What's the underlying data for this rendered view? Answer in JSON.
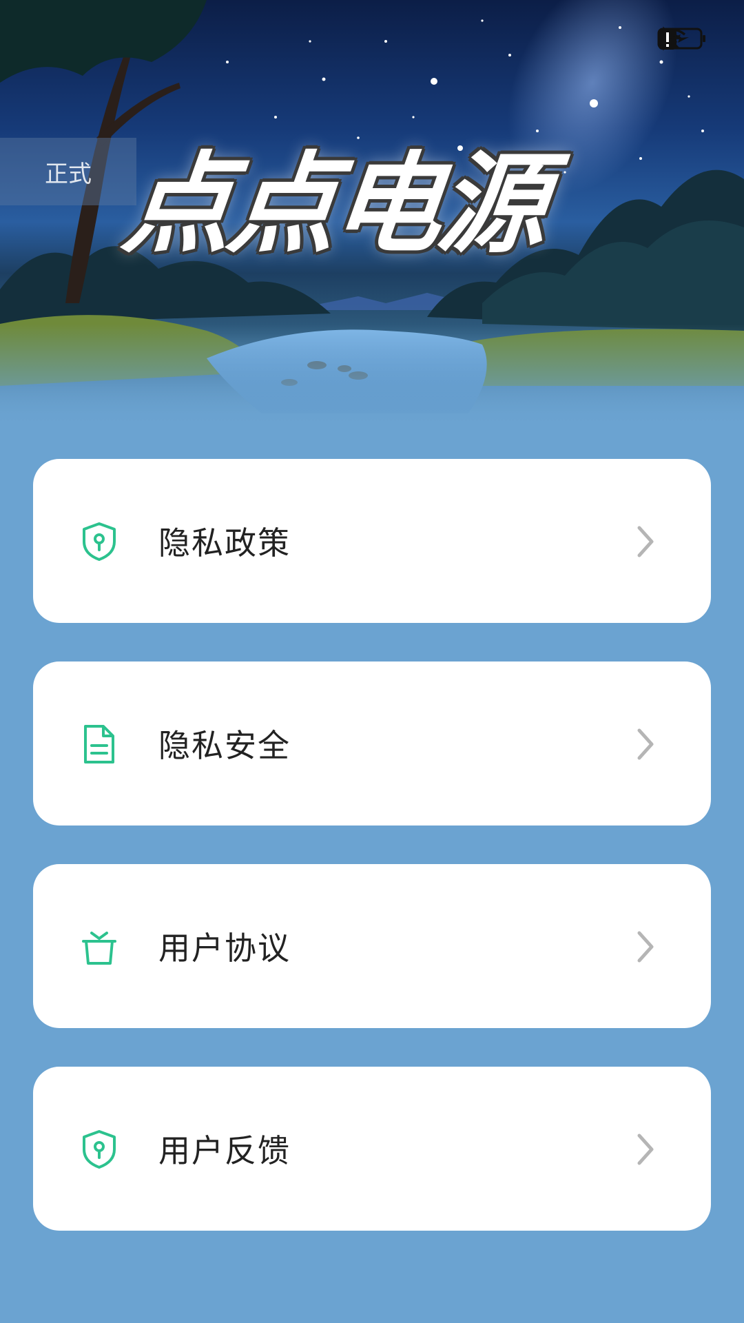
{
  "app": {
    "title": "点点电源",
    "env_badge": "正式"
  },
  "status_bar": {
    "icons": [
      "bluetooth-icon",
      "mute-bell-icon",
      "wifi-icon",
      "battery-alert-icon",
      "battery-charging-icon"
    ]
  },
  "colors": {
    "accent": "#2cc28e",
    "page_background": "#6ba3d1",
    "card_background": "#ffffff",
    "chevron": "#b5b5b5"
  },
  "menu": {
    "items": [
      {
        "label": "隐私政策",
        "icon": "shield-key-icon"
      },
      {
        "label": "隐私安全",
        "icon": "document-icon"
      },
      {
        "label": "用户协议",
        "icon": "gift-box-icon"
      },
      {
        "label": "用户反馈",
        "icon": "shield-key-icon"
      }
    ]
  }
}
